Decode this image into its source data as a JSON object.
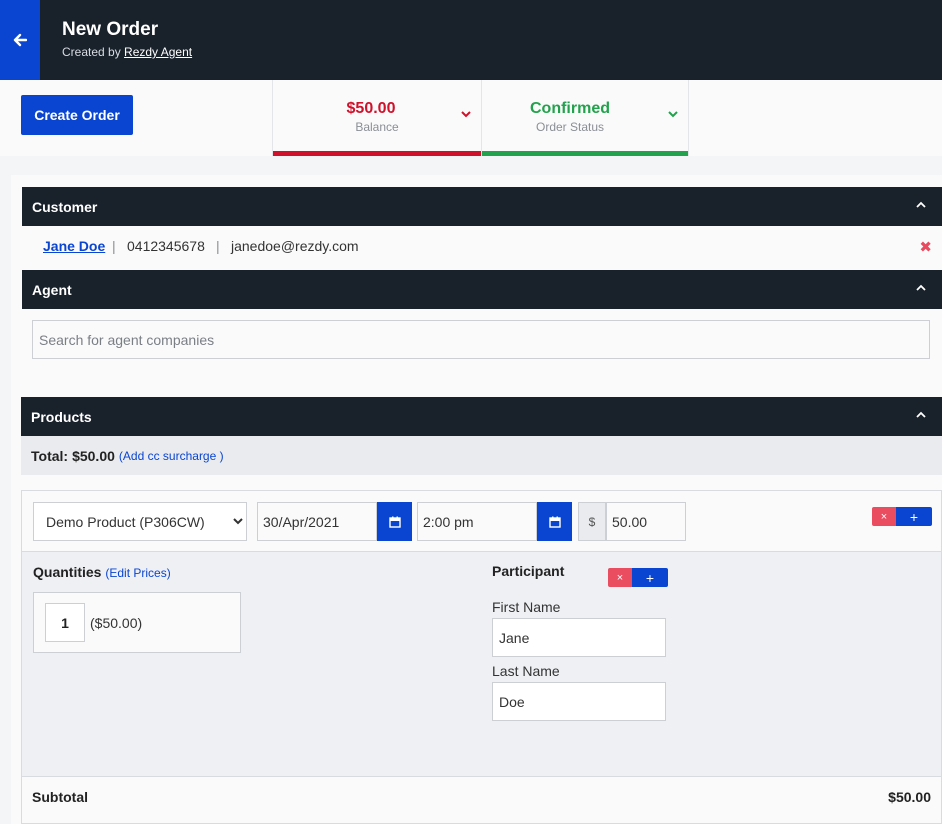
{
  "header": {
    "title": "New Order",
    "created_by_prefix": "Created by",
    "created_by_user": "Rezdy Agent"
  },
  "actions": {
    "create_order": "Create Order"
  },
  "balance": {
    "value": "$50.00",
    "label": "Balance"
  },
  "order_status": {
    "value": "Confirmed",
    "label": "Order Status"
  },
  "customer": {
    "heading": "Customer",
    "name": "Jane Doe",
    "separator": "|",
    "phone": "0412345678",
    "email": "janedoe@rezdy.com",
    "remove": "✖"
  },
  "agent": {
    "heading": "Agent",
    "search_placeholder": "Search for agent companies"
  },
  "products": {
    "heading": "Products",
    "total_label": "Total:",
    "total_value": "$50.00",
    "surcharge_link": "(Add cc surcharge )",
    "item": {
      "product": "Demo Product (P306CW)",
      "date": "30/Apr/2021",
      "time": "2:00 pm",
      "currency_symbol": "$",
      "price": "50.00",
      "remove": "×",
      "add": "+"
    },
    "quantities": {
      "label": "Quantities",
      "edit_prices": "(Edit Prices)",
      "qty": "1",
      "unit_price": "($50.00)"
    },
    "participant": {
      "label": "Participant",
      "remove": "×",
      "add": "+",
      "first_name_label": "First Name",
      "first_name": "Jane",
      "last_name_label": "Last Name",
      "last_name": "Doe"
    },
    "subtotal_label": "Subtotal",
    "subtotal_value": "$50.00"
  },
  "colors": {
    "brand_blue": "#0a45d1",
    "header_dark": "#19212b",
    "balance_red": "#d0112b",
    "status_green": "#23a24d",
    "remove_red": "#ea4c60"
  },
  "icons": {
    "back": "arrow-left-icon",
    "dropdown": "chevron-down-icon",
    "collapse": "chevron-up-icon",
    "calendar": "calendar-icon",
    "remove": "close-icon"
  }
}
